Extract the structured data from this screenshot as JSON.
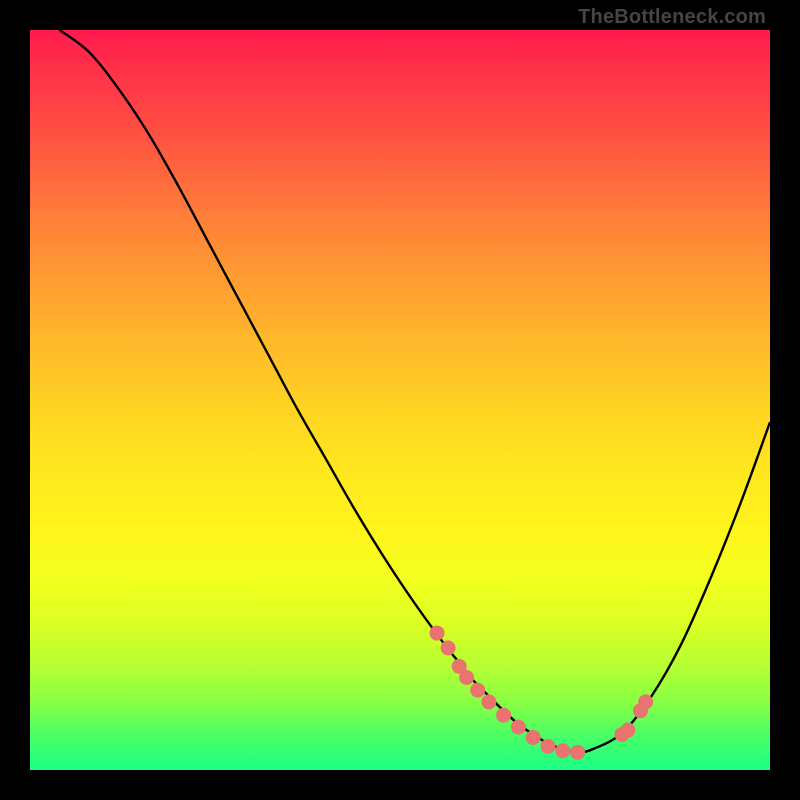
{
  "watermark": "TheBottleneck.com",
  "chart_data": {
    "type": "line",
    "title": "",
    "xlabel": "",
    "ylabel": "",
    "xlim": [
      0,
      100
    ],
    "ylim": [
      0,
      100
    ],
    "curve": {
      "name": "bottleneck-curve",
      "x": [
        4,
        8,
        12,
        16,
        20,
        24,
        28,
        32,
        36,
        40,
        44,
        48,
        52,
        56,
        58,
        60,
        62,
        64,
        66,
        68,
        70,
        72,
        74,
        76,
        80,
        84,
        88,
        92,
        96,
        100
      ],
      "y": [
        100,
        97,
        92,
        86,
        79,
        71.5,
        64,
        56.5,
        49,
        42,
        35,
        28.5,
        22.5,
        17,
        14.5,
        12,
        10,
        8,
        6.2,
        4.8,
        3.6,
        2.8,
        2.4,
        2.8,
        5,
        10,
        17,
        26,
        36,
        47
      ]
    },
    "points": {
      "name": "sample-points",
      "x": [
        55,
        56.5,
        58,
        59,
        60.5,
        62,
        64,
        66,
        68,
        70,
        72,
        74,
        80,
        80.8,
        82.5,
        83.2
      ],
      "y": [
        18.5,
        16.5,
        14,
        12.5,
        10.8,
        9.2,
        7.4,
        5.8,
        4.4,
        3.2,
        2.6,
        2.4,
        4.8,
        5.4,
        8.0,
        9.2
      ]
    },
    "colors": {
      "gradient_top": "#ff1a4d",
      "gradient_bottom": "#1aff85",
      "curve": "#000000",
      "points": "#e9736e",
      "frame": "#000000"
    }
  }
}
